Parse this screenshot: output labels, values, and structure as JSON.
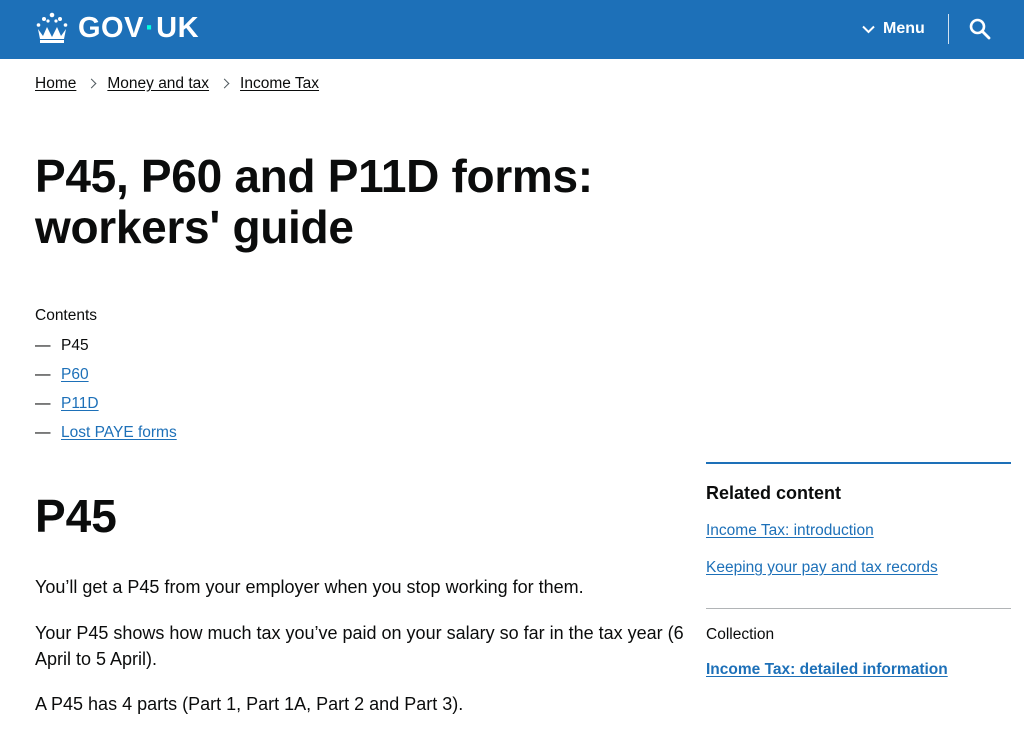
{
  "header": {
    "logo": {
      "text_left": "GOV",
      "dot": "·",
      "text_right": "UK"
    },
    "menu_label": "Menu",
    "search_icon": "search-icon",
    "background_color": "#1d70b8"
  },
  "breadcrumb": [
    {
      "label": "Home"
    },
    {
      "label": "Money and tax"
    },
    {
      "label": "Income Tax"
    }
  ],
  "page": {
    "title": "P45, P60 and P11D forms: workers' guide"
  },
  "contents": {
    "heading": "Contents",
    "dash": "—",
    "items": [
      {
        "label": "P45",
        "current": true
      },
      {
        "label": "P60",
        "current": false
      },
      {
        "label": "P11D",
        "current": false
      },
      {
        "label": "Lost PAYE forms",
        "current": false
      }
    ]
  },
  "section": {
    "heading": "P45",
    "paragraphs": [
      "You’ll get a P45 from your employer when you stop working for them.",
      "Your P45 shows how much tax you’ve paid on your salary so far in the tax year (6 April to 5 April).",
      "A P45 has 4 parts (Part 1, Part 1A, Part 2 and Part 3)."
    ]
  },
  "related": {
    "heading": "Related content",
    "links": [
      {
        "label": "Income Tax: introduction"
      },
      {
        "label": "Keeping your pay and tax records"
      }
    ],
    "collection_label": "Collection",
    "collection_link": "Income Tax: detailed information"
  },
  "colors": {
    "link": "#1d70b8",
    "text": "#0b0c0c",
    "divider": "#b1b4b6"
  }
}
